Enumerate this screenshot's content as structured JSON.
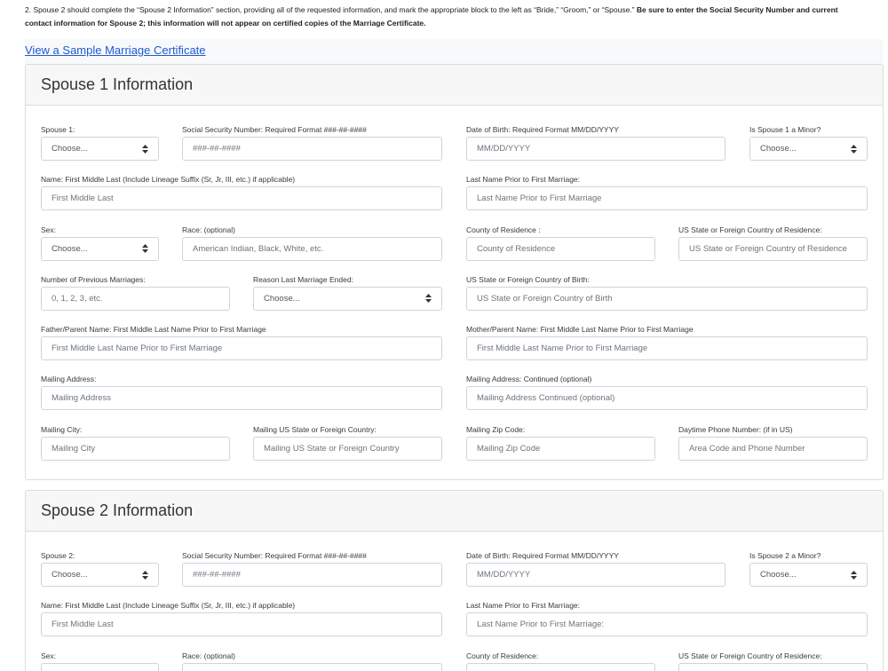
{
  "theme": {
    "link_color": "#1f5ad1"
  },
  "instructions": {
    "intro": "2. Spouse 2 should complete the “Spouse 2 Information” section, providing all of the requested information, and mark the appropriate block to the left as “Bride,” “Groom,” or “Spouse.”",
    "emphasis": "Be sure to enter the Social Security Number and current contact information for Spouse 2; this information will not appear on certified copies of the Marriage Certificate."
  },
  "sample_link": {
    "label": "View a Sample Marriage Certificate"
  },
  "spouse1": {
    "title": "Spouse 1 Information",
    "spouse_role": {
      "label": "Spouse 1:",
      "value": "Choose..."
    },
    "ssn": {
      "label": "Social Security Number: Required Format ###-##-####",
      "placeholder": "###-##-####"
    },
    "dob": {
      "label": "Date of Birth: Required Format MM/DD/YYYY",
      "placeholder": "MM/DD/YYYY"
    },
    "minor": {
      "label": "Is Spouse 1 a Minor?",
      "value": "Choose..."
    },
    "name": {
      "label": "Name: First Middle Last (Include Lineage Suffix (Sr, Jr, III, etc.) if applicable)",
      "placeholder": "First Middle Last"
    },
    "prior_last_name": {
      "label": "Last Name Prior to First Marriage:",
      "placeholder": "Last Name Prior to First Marriage"
    },
    "sex": {
      "label": "Sex:",
      "value": "Choose..."
    },
    "race": {
      "label": "Race: (optional)",
      "placeholder": "American Indian, Black, White, etc."
    },
    "county": {
      "label": "County of Residence :",
      "placeholder": "County of Residence"
    },
    "residence_state": {
      "label": "US State or Foreign Country of Residence:",
      "placeholder": "US State or Foreign Country of Residence"
    },
    "previous_marriages": {
      "label": "Number of Previous Marriages:",
      "placeholder": "0, 1, 2, 3, etc."
    },
    "reason_ended": {
      "label": "Reason Last Marriage Ended:",
      "value": "Choose..."
    },
    "birth_state": {
      "label": "US State or Foreign Country of Birth:",
      "placeholder": "US State or Foreign Country of Birth"
    },
    "father_name": {
      "label": "Father/Parent Name: First Middle Last Name Prior to First Marriage",
      "placeholder": "First Middle Last Name Prior to First Marriage"
    },
    "mother_name": {
      "label": "Mother/Parent Name: First Middle Last Name Prior to First Marriage",
      "placeholder": "First Middle Last Name Prior to First Marriage"
    },
    "mailing_address": {
      "label": "Mailing Address:",
      "placeholder": "Mailing Address"
    },
    "mailing_address_2": {
      "label": "Mailing Address: Continued (optional)",
      "placeholder": "Mailing Address Continued (optional)"
    },
    "mailing_city": {
      "label": "Mailing City:",
      "placeholder": "Mailing City"
    },
    "mailing_state": {
      "label": "Mailing US State or Foreign Country:",
      "placeholder": "Mailing US State or Foreign Country"
    },
    "mailing_zip": {
      "label": "Mailing Zip Code:",
      "placeholder": "Mailing Zip Code"
    },
    "phone": {
      "label": "Daytime Phone Number: (if in US)",
      "placeholder": "Area Code and Phone Number"
    }
  },
  "spouse2": {
    "title": "Spouse 2 Information",
    "spouse_role": {
      "label": "Spouse 2:",
      "value": "Choose..."
    },
    "ssn": {
      "label": "Social Security Number: Required Format ###-##-####",
      "placeholder": "###-##-####"
    },
    "dob": {
      "label": "Date of Birth: Required Format MM/DD/YYYY",
      "placeholder": "MM/DD/YYYY"
    },
    "minor": {
      "label": "Is Spouse 2 a Minor?",
      "value": "Choose..."
    },
    "name": {
      "label": "Name: First Middle Last (Include Lineage Suffix (Sr, Jr, III, etc.) if applicable)",
      "placeholder": "First Middle Last"
    },
    "prior_last_name": {
      "label": "Last Name Prior to First Marriage:",
      "placeholder": "Last Name Prior to First Marriage:"
    },
    "sex": {
      "label": "Sex:"
    },
    "race": {
      "label": "Race: (optional)"
    },
    "county": {
      "label": "County of Residence:"
    },
    "residence_state": {
      "label": "US State or Foreign Country of Residence:"
    }
  }
}
